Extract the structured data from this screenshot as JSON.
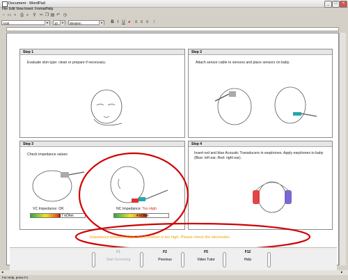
{
  "window": {
    "title": "Document - WordPad"
  },
  "menu": [
    "File",
    "Edit",
    "View",
    "Insert",
    "Format",
    "Help"
  ],
  "format_bar": {
    "font": "Arial",
    "size": "10",
    "script": "Western"
  },
  "steps": [
    {
      "heading": "Step 1",
      "text": "Evaluate skin type: clean or prepare if necessary."
    },
    {
      "heading": "Step 2",
      "text": "Attach sensor cable to sensors and place sensors on baby."
    },
    {
      "heading": "Step 3",
      "text": "Check impedance values"
    },
    {
      "heading": "Step 4",
      "text": "Insert red and blue Acoustic Transducers in earphones. Apply earphones to baby (Blue: left ear, Red: right ear)."
    }
  ],
  "impedance": {
    "vc": {
      "label": "VC Impedance:",
      "status": "OK",
      "value": "3.7 kOhm",
      "level_fraction": 0.55
    },
    "nc": {
      "label": "NC Impedance:",
      "status": "Too High",
      "value": "4 kOhm",
      "level_fraction": 0.6
    }
  },
  "alert": "Impedance between Nape and Common is too high. Please check the electrodes.",
  "function_keys": [
    {
      "key": "F1",
      "label": "Start Screening",
      "enabled": false
    },
    {
      "key": "F2",
      "label": "Previous",
      "enabled": true
    },
    {
      "key": "F5",
      "label": "Video Tutor",
      "enabled": true
    },
    {
      "key": "F12",
      "label": "Help",
      "enabled": true
    }
  ],
  "status_bar": "For Help, press F1",
  "colors": {
    "alert_text": "#f0a000",
    "too_high_text": "#e02020",
    "highlight_ring": "#d00000"
  }
}
